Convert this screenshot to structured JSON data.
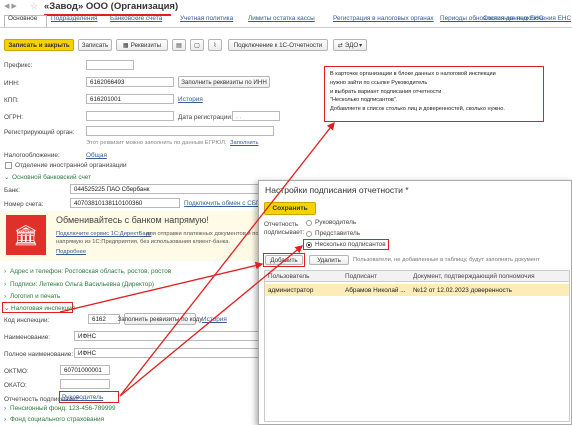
{
  "window": {
    "title": "«Завод» ООО (Организация)"
  },
  "tabs": [
    "Основное",
    "Подразделения",
    "Банковские счета",
    "Учетная политика",
    "Лимиты остатка кассы",
    "Регистрация в налоговых органах",
    "Периоды обновления данных ЕНС",
    "Состояния подключения ЕНС"
  ],
  "toolbar": {
    "save_close": "Записать и закрыть",
    "save": "Записать",
    "requisites": "Реквизиты",
    "connect": "Подключение к 1С-Отчетности",
    "edo": "ЭДО"
  },
  "form": {
    "prefix_label": "Префикс:",
    "inn_label": "ИНН:",
    "inn": "6162066493",
    "fill_inn": "Заполнить реквизиты по ИНН",
    "kpp_label": "КПП:",
    "kpp": "616201001",
    "history": "История",
    "ogrn_label": "ОГРН:",
    "reg_date_label": "Дата регистрации:",
    "reg_date": ". .",
    "reg_organ_label": "Регистрирующий орган:",
    "egrul_hint": "Этот реквизит можно заполнить по данным ЕГРЮЛ.",
    "fill": "Заполнить",
    "tax_label": "Налогообложение:",
    "tax_value": "Общая",
    "foreign_label": "Отделение иностранной организации",
    "bank_section": "Основной банковский счет",
    "bank_label": "Банк:",
    "bank_value": "044525225 ПАО Сбербанк",
    "account_label": "Номер счета:",
    "account_value": "40703810138110100360",
    "sbp_link": "Подключить обмен с СБП",
    "promo_title": "Обменивайтесь с банком напрямую!",
    "promo_link": "Подключите сервис 1С:ДиректБанк",
    "promo_text1": "для отправки платежных документов и получения выписок",
    "promo_text2": "напрямую из 1С:Предприятия, без использования клиент-банка.",
    "promo_more": "Подробнее",
    "address_section": "Адрес и телефон: Ростовская область, ростов, ростов",
    "signatures_section": "Подписи: Литенко Ольга Васильевна (Директор)",
    "logo_section": "Логотип и печать",
    "tax_section": "Налоговая инспекция",
    "tax_code_label": "Код инспекции:",
    "tax_code": "6162",
    "fill_code": "Заполнить реквизиты по коду",
    "history2": "История",
    "name_label": "Наименование:",
    "name_value": "ИФНС",
    "full_name_label": "Полное наименование:",
    "full_name_value": "ИФНС",
    "oktmo_label": "ОКТМО:",
    "oktmo_value": "60701000001",
    "okato_label": "ОКАТО:",
    "signs_label": "Отчетность подписывает:",
    "signs_value": "Руководитель",
    "pension": "Пенсионный фонд: 123-456-789999",
    "fss": "Фонд социального страхования"
  },
  "callout": {
    "lines": [
      "В карточке организации в блоке данных о налоговой инспекции",
      "нужно зайти по ссылке Руководитель",
      "и выбрать вариант подписания отчетности",
      "\"Несколько подписантов\".",
      "Добавляете в список столько лиц и доверенностей, сколько нужно."
    ]
  },
  "dialog": {
    "title": "Настройки подписания отчетности *",
    "save": "Сохранить",
    "signs_label": "Отчетность подписывает:",
    "opt1": "Руководитель",
    "opt2": "Представитель",
    "opt3": "Несколько подписантов",
    "add": "Добавить",
    "delete": "Удалить",
    "hint": "Пользователи, не добавленные в таблицу, будут заполнять документ",
    "col_user": "Пользователь",
    "col_signer": "Подписант",
    "col_doc": "Документ, подтверждающий полномочия",
    "rows": [
      {
        "user": "администратор",
        "signer": "Абрамов Николай ...",
        "doc": "№12 от 12.02.2023 доверенность"
      }
    ]
  },
  "colors": {
    "accent_red": "#e02020",
    "save_yellow": "#f5d200",
    "link_blue": "#3a5a98",
    "green": "#2a7b3c"
  }
}
